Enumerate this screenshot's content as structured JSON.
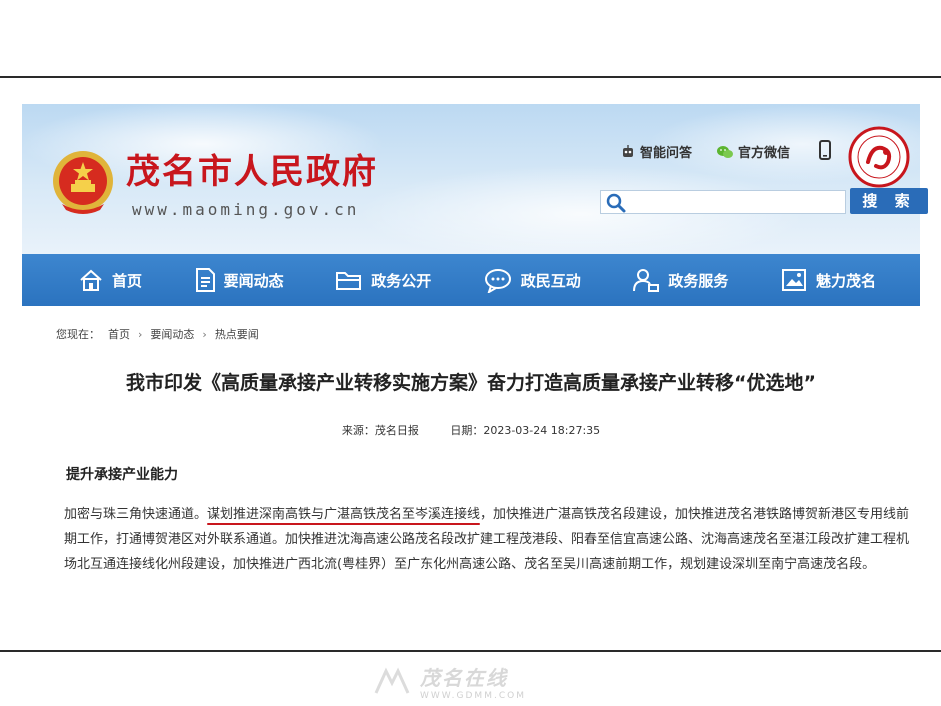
{
  "header": {
    "site_title": "茂名市人民政府",
    "site_url": "www.maoming.gov.cn",
    "tools": [
      "智能问答",
      "官方微信"
    ],
    "search_placeholder": "",
    "search_button": "搜 索"
  },
  "nav": {
    "items": [
      {
        "label": "首页",
        "icon": "home-icon"
      },
      {
        "label": "要闻动态",
        "icon": "document-icon"
      },
      {
        "label": "政务公开",
        "icon": "folder-icon"
      },
      {
        "label": "政民互动",
        "icon": "chat-icon"
      },
      {
        "label": "政务服务",
        "icon": "user-service-icon"
      },
      {
        "label": "魅力茂名",
        "icon": "picture-icon"
      }
    ]
  },
  "breadcrumb": {
    "prefix": "您现在：",
    "items": [
      "首页",
      "要闻动态",
      "热点要闻"
    ]
  },
  "article": {
    "title": "我市印发《高质量承接产业转移实施方案》奋力打造高质量承接产业转移“优选地”",
    "source": "来源：茂名日报",
    "date": "日期：2023-03-24 18:27:35",
    "section_heading": "提升承接产业能力",
    "para_before": "加密与珠三角快速通道。",
    "para_highlight": "谋划推进深南高铁与广湛高铁茂名至岑溪连接线",
    "para_after": "，加快推进广湛高铁茂名段建设，加快推进茂名港铁路博贺新港区专用线前期工作，打通博贺港区对外联系通道。加快推进沈海高速公路茂名段改扩建工程茂港段、阳春至信宜高速公路、沈海高速茂名至湛江段改扩建工程机场北互通连接线化州段建设，加快推进广西北流(粤桂界）至广东化州高速公路、茂名至吴川高速前期工作，规划建设深圳至南宁高速茂名段。"
  },
  "watermark": {
    "text": "茂名在线",
    "url": "WWW.GDMM.COM"
  },
  "colors": {
    "accent_red": "#c8161d",
    "nav_blue": "#2b73bf",
    "button_blue": "#2a6cb8"
  }
}
